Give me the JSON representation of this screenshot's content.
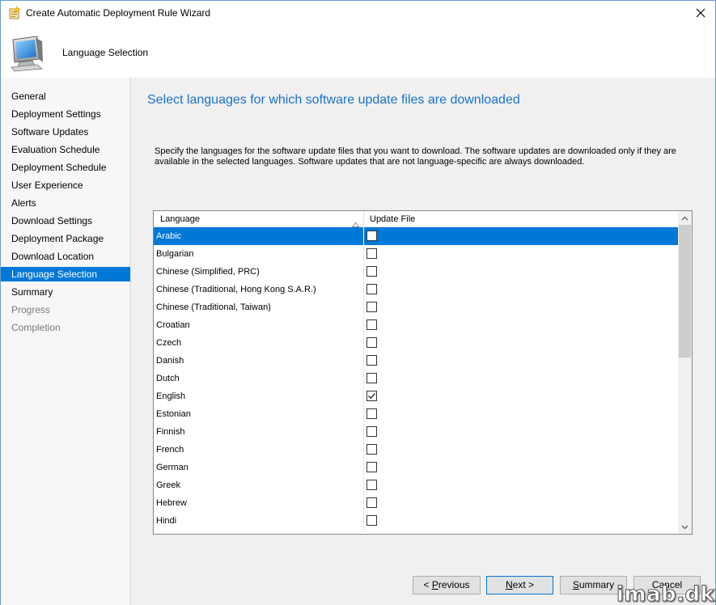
{
  "window": {
    "title": "Create Automatic Deployment Rule Wizard"
  },
  "header": {
    "title": "Language Selection"
  },
  "sidebar": {
    "items": [
      {
        "label": "General",
        "state": "normal"
      },
      {
        "label": "Deployment Settings",
        "state": "normal"
      },
      {
        "label": "Software Updates",
        "state": "normal"
      },
      {
        "label": "Evaluation Schedule",
        "state": "normal"
      },
      {
        "label": "Deployment Schedule",
        "state": "normal"
      },
      {
        "label": "User Experience",
        "state": "normal"
      },
      {
        "label": "Alerts",
        "state": "normal"
      },
      {
        "label": "Download Settings",
        "state": "normal"
      },
      {
        "label": "Deployment Package",
        "state": "normal"
      },
      {
        "label": "Download Location",
        "state": "normal"
      },
      {
        "label": "Language Selection",
        "state": "active"
      },
      {
        "label": "Summary",
        "state": "normal"
      },
      {
        "label": "Progress",
        "state": "disabled"
      },
      {
        "label": "Completion",
        "state": "disabled"
      }
    ]
  },
  "main": {
    "heading": "Select languages for which software update files are downloaded",
    "description": "Specify the languages for the software update files that you want to download. The software updates are downloaded only if they are available in the selected languages. Software updates that are not language-specific are always downloaded."
  },
  "grid": {
    "columns": [
      "Language",
      "Update File"
    ],
    "rows": [
      {
        "language": "Arabic",
        "checked": false,
        "selected": true
      },
      {
        "language": "Bulgarian",
        "checked": false,
        "selected": false
      },
      {
        "language": "Chinese (Simplified, PRC)",
        "checked": false,
        "selected": false
      },
      {
        "language": "Chinese (Traditional, Hong Kong S.A.R.)",
        "checked": false,
        "selected": false
      },
      {
        "language": "Chinese (Traditional, Taiwan)",
        "checked": false,
        "selected": false
      },
      {
        "language": "Croatian",
        "checked": false,
        "selected": false
      },
      {
        "language": "Czech",
        "checked": false,
        "selected": false
      },
      {
        "language": "Danish",
        "checked": false,
        "selected": false
      },
      {
        "language": "Dutch",
        "checked": false,
        "selected": false
      },
      {
        "language": "English",
        "checked": true,
        "selected": false
      },
      {
        "language": "Estonian",
        "checked": false,
        "selected": false
      },
      {
        "language": "Finnish",
        "checked": false,
        "selected": false
      },
      {
        "language": "French",
        "checked": false,
        "selected": false
      },
      {
        "language": "German",
        "checked": false,
        "selected": false
      },
      {
        "language": "Greek",
        "checked": false,
        "selected": false
      },
      {
        "language": "Hebrew",
        "checked": false,
        "selected": false
      },
      {
        "language": "Hindi",
        "checked": false,
        "selected": false
      }
    ]
  },
  "footer": {
    "previous": {
      "pre": "< ",
      "mnemonic": "P",
      "rest": "revious"
    },
    "next": {
      "pre": "",
      "mnemonic": "N",
      "rest": "ext >"
    },
    "summary": {
      "pre": "",
      "mnemonic": "S",
      "rest": "ummary"
    },
    "cancel": {
      "pre": "",
      "mnemonic": "",
      "rest": "Cancel"
    }
  },
  "watermark": "imab.dk",
  "colors": {
    "accent": "#0078d7",
    "heading": "#1a73c9"
  },
  "icons": {
    "title": "wizard-icon",
    "header": "computer-monitor-icon"
  }
}
